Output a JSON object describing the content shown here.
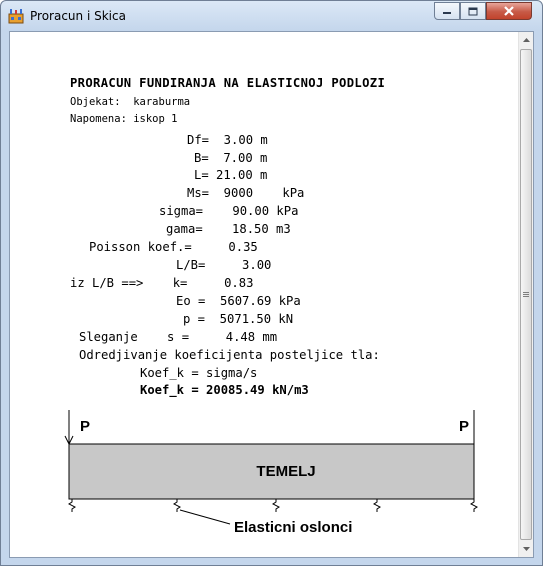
{
  "window": {
    "title": "Proracun i Skica",
    "controls": [
      "minimize",
      "maximize",
      "close"
    ]
  },
  "report": {
    "heading": "PRORACUN FUNDIRANJA NA ELASTICNOJ PODLOZI",
    "objekat": "Objekat:  karaburma",
    "napomena": "Napomena: iskop 1",
    "lines": [
      "Df=  3.00 m",
      "B=  7.00 m",
      "L= 21.00 m",
      "Ms=  9000    kPa",
      "sigma=    90.00 kPa",
      "gama=    18.50 m3",
      "Poisson koef.=     0.35",
      "L/B=     3.00",
      "iz L/B ==>    k=     0.83",
      "Eo =  5607.69 kPa",
      "p =  5071.50 kN",
      "Sleganje    s =     4.48 mm",
      "Odredjivanje koeficijenta posteljice tla:",
      "Koef_k = sigma/s",
      "Koef_k = 20085.49 kN/m3"
    ]
  },
  "sketch": {
    "load_left": "P",
    "load_right": "P",
    "foundation_label": "TEMELJ",
    "supports_label": "Elasticni oslonci",
    "foundation_fill": "#c8c8c8"
  }
}
